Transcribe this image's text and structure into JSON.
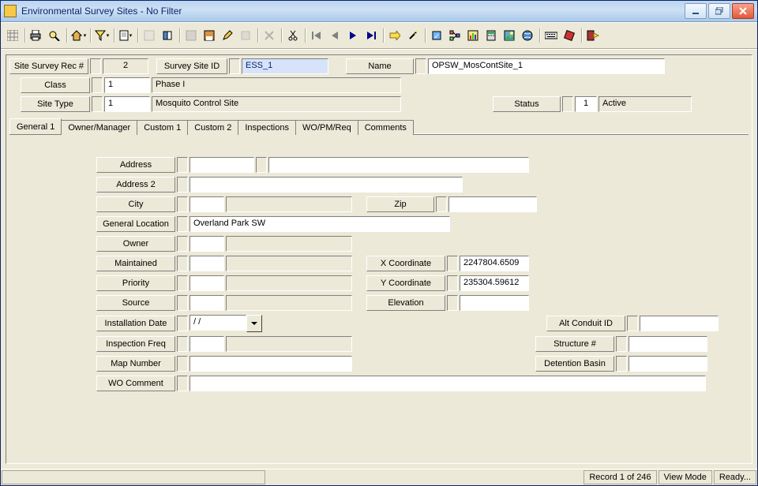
{
  "window": {
    "title": "Environmental Survey Sites - No Filter"
  },
  "toolbar_icons": [
    "print",
    "find",
    "home",
    "funnel",
    "doc",
    "doc2",
    "book",
    "disk",
    "save",
    "pencil",
    "book2",
    "x",
    "scissors",
    "first",
    "prev",
    "next",
    "last",
    "goto",
    "wand",
    "wiz",
    "tree",
    "bar",
    "calc",
    "pic",
    "globe",
    "kbd",
    "erase",
    "door"
  ],
  "header": {
    "site_rec_label": "Site Survey Rec #",
    "site_rec_value": "2",
    "site_id_label": "Survey Site ID",
    "site_id_value": "ESS_1",
    "name_label": "Name",
    "name_value": "OPSW_MosContSite_1",
    "class_label": "Class",
    "class_code": "1",
    "class_desc": "Phase I",
    "type_label": "Site Type",
    "type_code": "1",
    "type_desc": "Mosquito Control Site",
    "status_label": "Status",
    "status_code": "1",
    "status_desc": "Active"
  },
  "tabs": [
    "General 1",
    "Owner/Manager",
    "Custom 1",
    "Custom 2",
    "Inspections",
    "WO/PM/Req",
    "Comments"
  ],
  "form": {
    "address": "Address",
    "address2": "Address 2",
    "city": "City",
    "zip": "Zip",
    "genloc": "General Location",
    "genloc_val": "Overland Park SW",
    "owner": "Owner",
    "maintained": "Maintained",
    "priority": "Priority",
    "source": "Source",
    "xcoord": "X Coordinate",
    "xcoord_val": "2247804.6509",
    "ycoord": "Y Coordinate",
    "ycoord_val": "235304.59612",
    "elev": "Elevation",
    "install": "Installation Date",
    "install_val": "  /   /",
    "insp": "Inspection Freq",
    "map": "Map Number",
    "alt": "Alt Conduit ID",
    "struct": "Structure #",
    "det": "Detention Basin",
    "wocomment": "WO Comment"
  },
  "status": {
    "record": "Record 1 of 246",
    "mode": "View Mode",
    "ready": "Ready..."
  }
}
